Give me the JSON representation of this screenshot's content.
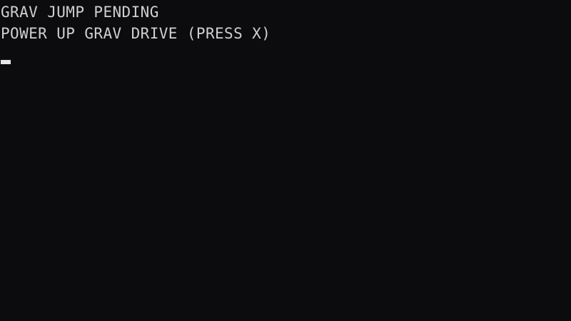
{
  "terminal": {
    "lines": [
      "GRAV JUMP PENDING",
      "POWER UP GRAV DRIVE (PRESS X)"
    ],
    "colors": {
      "background": "#0c0b0e",
      "text": "#cfcfcf",
      "cursor": "#e6e6e6"
    }
  }
}
